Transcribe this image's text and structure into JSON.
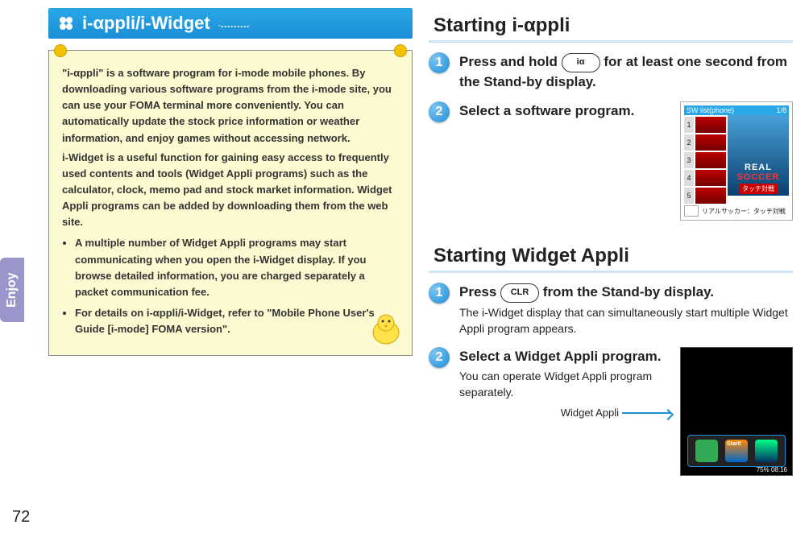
{
  "sideTab": "Enjoy",
  "pageNumber": "72",
  "banner": {
    "title": "i-αppli/i-Widget"
  },
  "pinBox": {
    "paragraph1": "\"i-αppli\" is a software program for i-mode mobile phones. By downloading various software programs from the i-mode site, you can use your FOMA terminal more conveniently. You can automatically update the stock price information or weather information, and enjoy games without accessing network.",
    "paragraph2": "i-Widget is a useful function for gaining easy access to frequently used contents and tools (Widget Appli programs) such as the calculator, clock, memo pad and stock market information. Widget Appli programs can be added by downloading them from the web site.",
    "bullets": [
      "A multiple number of Widget Appli programs may start communicating when you open the i-Widget display. If you browse detailed information, you are charged separately a packet communication fee.",
      "For details on i-αppli/i-Widget, refer to \"Mobile Phone User's Guide [i-mode] FOMA version\"."
    ]
  },
  "section1": {
    "heading": "Starting i-αppli",
    "step1": {
      "num": "1",
      "text_a": "Press and hold ",
      "key_label": "iα",
      "text_b": " for at least one second from the Stand-by display."
    },
    "step2": {
      "num": "2",
      "text": "Select a software program."
    },
    "screenshot": {
      "header_left": "SW list(phone)",
      "header_right": "1/8",
      "rows": [
        "1",
        "2",
        "3",
        "4",
        "5"
      ],
      "appTitle1": "REAL",
      "appTitle2": "SOCCER",
      "appSub": "タッチ対戦",
      "bottomText": "リアルサッカー：タッチ対戦"
    }
  },
  "section2": {
    "heading": "Starting Widget Appli",
    "step1": {
      "num": "1",
      "bold_a": "Press ",
      "key_label": "CLR",
      "bold_b": " from the Stand-by display.",
      "desc": "The i-Widget display that can simultaneously start multiple Widget Appli program appears."
    },
    "step2": {
      "num": "2",
      "bold": "Select a Widget Appli program.",
      "desc": "You can operate Widget Appli program separately."
    },
    "widgetShot": {
      "startLabel": "Start!",
      "percent": "75%",
      "time": "08:16"
    },
    "callout": "Widget Appli"
  }
}
